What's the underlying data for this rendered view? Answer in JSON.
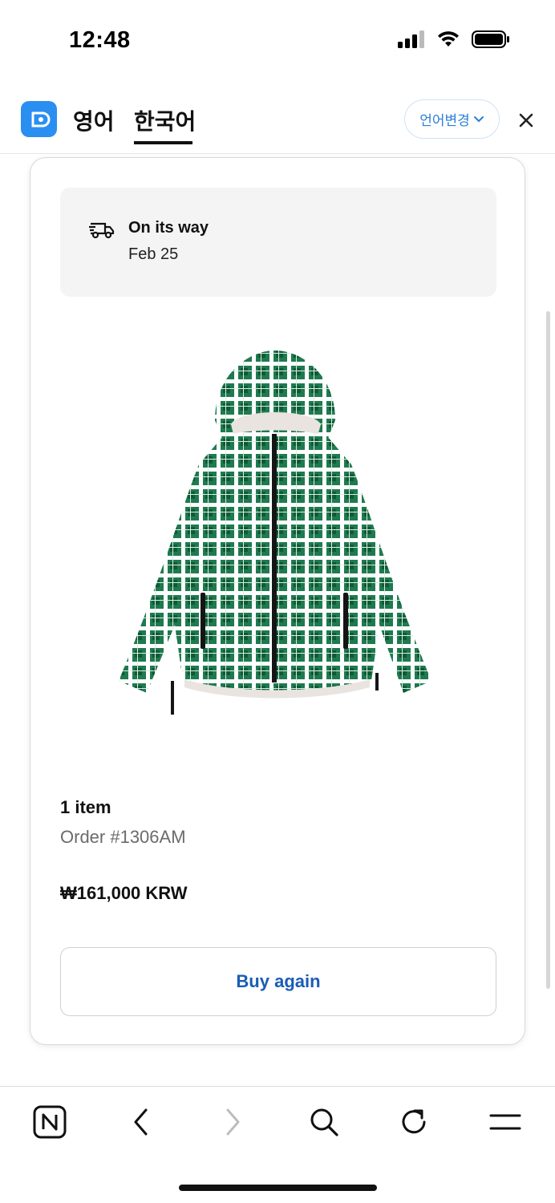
{
  "status_bar": {
    "time": "12:48"
  },
  "header": {
    "tabs": [
      {
        "label": "영어",
        "active": false
      },
      {
        "label": "한국어",
        "active": true
      }
    ],
    "language_change_label": "언어변경"
  },
  "order": {
    "status_title": "On its way",
    "status_date": "Feb 25",
    "item_count": "1 item",
    "order_number": "Order #1306AM",
    "price": "₩161,000 KRW",
    "buy_again_label": "Buy again"
  },
  "colors": {
    "accent_blue": "#2b8ff2",
    "link_blue": "#1a5cb5",
    "jacket_green": "#1f7a4f"
  },
  "icons": {
    "truck": "truck-icon",
    "close": "close-icon",
    "chevron": "chevron-down-icon",
    "toolbar": [
      "n-logo-icon",
      "back-icon",
      "forward-icon",
      "search-icon",
      "refresh-icon",
      "menu-icon"
    ]
  }
}
